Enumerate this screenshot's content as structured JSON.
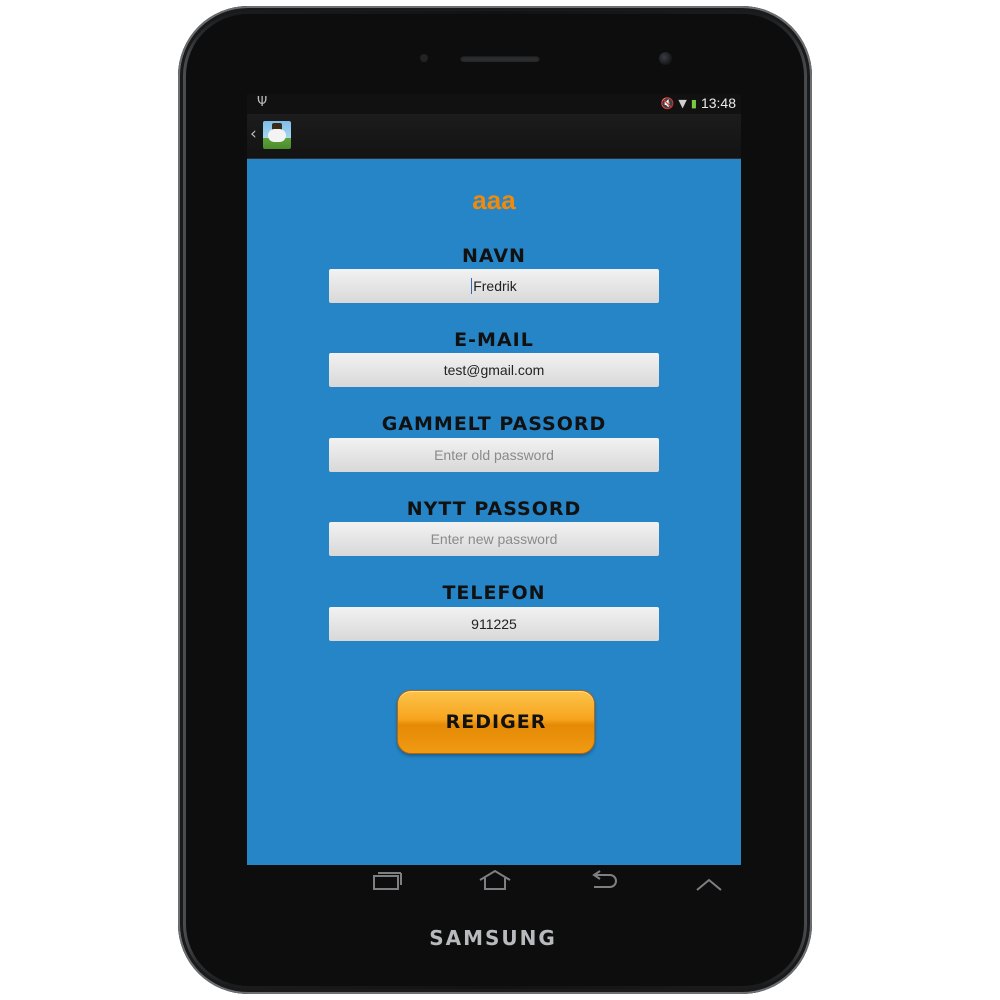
{
  "device": {
    "brand": "SAMSUNG"
  },
  "status_bar": {
    "time": "13:48",
    "usb_icon": "usb-icon",
    "mute_icon": "mute-icon",
    "wifi_icon": "wifi-icon",
    "battery_icon": "battery-icon"
  },
  "action_bar": {
    "back_icon": "chevron-left-icon",
    "logo_icon": "app-logo-icon"
  },
  "form": {
    "title": "aaa",
    "fields": [
      {
        "label": "NAVN",
        "value": "Fredrik",
        "placeholder": ""
      },
      {
        "label": "E-MAIL",
        "value": "test@gmail.com",
        "placeholder": ""
      },
      {
        "label": "GAMMELT PASSORD",
        "value": "",
        "placeholder": "Enter old password"
      },
      {
        "label": "NYTT PASSORD",
        "value": "",
        "placeholder": "Enter new password"
      },
      {
        "label": "TELEFON",
        "value": "911225",
        "placeholder": ""
      }
    ],
    "submit_label": "REDIGER"
  },
  "nav_bar": {
    "recents_icon": "recent-apps-icon",
    "home_icon": "home-icon",
    "back_icon": "back-arrow-icon",
    "menu_icon": "chevron-up-icon"
  },
  "colors": {
    "background": "#2685c6",
    "title": "#f08a0c",
    "button": "#f7a51f"
  }
}
